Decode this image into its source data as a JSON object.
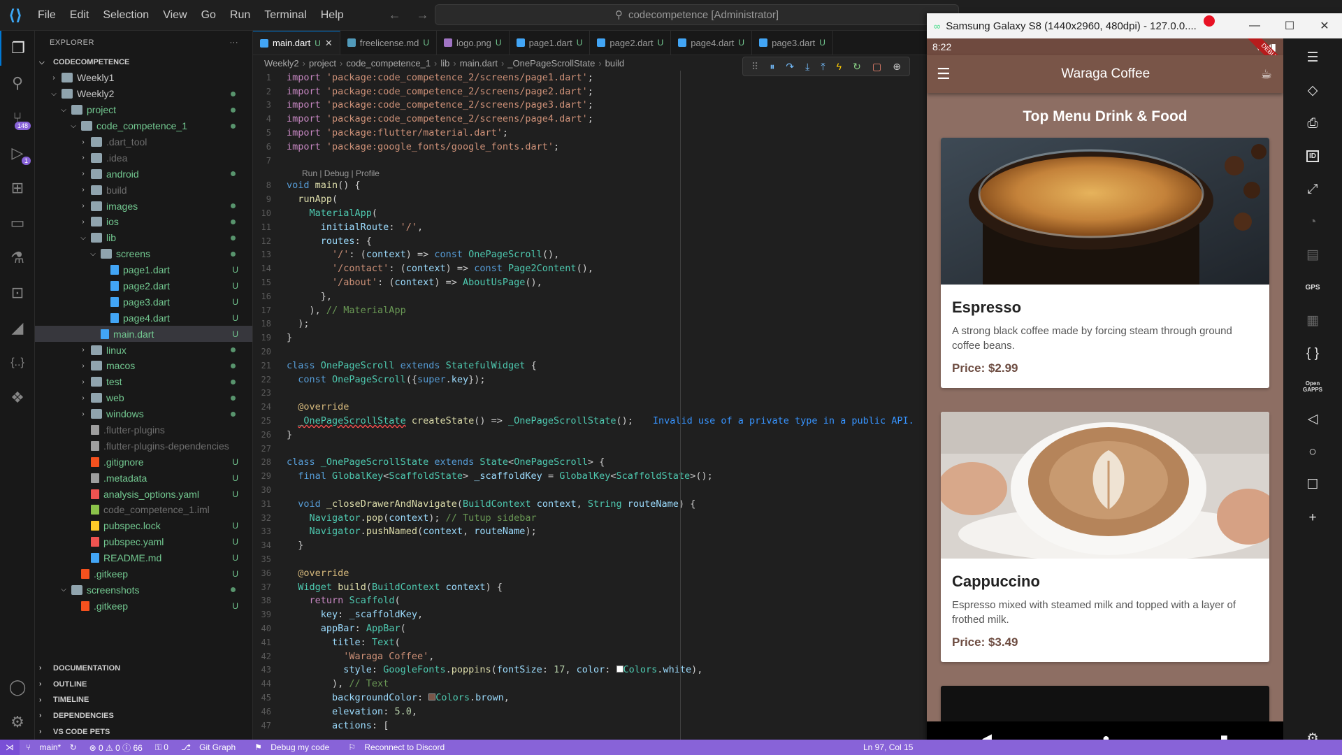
{
  "titlebar": {
    "menu": [
      "File",
      "Edit",
      "Selection",
      "View",
      "Go",
      "Run",
      "Terminal",
      "Help"
    ],
    "search_text": "codecompetence [Administrator]"
  },
  "activity": {
    "icons": [
      "files-icon",
      "search-icon",
      "source-control-icon",
      "run-debug-icon",
      "extensions-icon",
      "remote-explorer-icon",
      "testing-icon",
      "terminal-icon",
      "flutter-icon",
      "json-icon",
      "pets-icon"
    ],
    "scm_badge": "148",
    "debug_badge": "1"
  },
  "explorer": {
    "header": "EXPLORER",
    "more": "···",
    "root": "CODECOMPETENCE",
    "tree": [
      {
        "label": "Weekly1",
        "depth": 1,
        "type": "folder",
        "state": "closed",
        "color": "#cccccc",
        "mark": ""
      },
      {
        "label": "Weekly2",
        "depth": 1,
        "type": "folder",
        "state": "open",
        "color": "#cccccc",
        "mark": "dot"
      },
      {
        "label": "project",
        "depth": 2,
        "type": "folder",
        "state": "open",
        "color": "#73c991",
        "mark": "dot"
      },
      {
        "label": "code_competence_1",
        "depth": 3,
        "type": "folder",
        "state": "open",
        "color": "#73c991",
        "mark": "dot"
      },
      {
        "label": ".dart_tool",
        "depth": 4,
        "type": "folder",
        "state": "closed",
        "color": "#6e6e6e",
        "mark": ""
      },
      {
        "label": ".idea",
        "depth": 4,
        "type": "folder",
        "state": "closed",
        "color": "#6e6e6e",
        "mark": ""
      },
      {
        "label": "android",
        "depth": 4,
        "type": "folder",
        "state": "closed",
        "color": "#73c991",
        "mark": "dot"
      },
      {
        "label": "build",
        "depth": 4,
        "type": "folder",
        "state": "closed",
        "color": "#6e6e6e",
        "mark": ""
      },
      {
        "label": "images",
        "depth": 4,
        "type": "folder",
        "state": "closed",
        "color": "#73c991",
        "mark": "dot"
      },
      {
        "label": "ios",
        "depth": 4,
        "type": "folder",
        "state": "closed",
        "color": "#73c991",
        "mark": "dot"
      },
      {
        "label": "lib",
        "depth": 4,
        "type": "folder",
        "state": "open",
        "color": "#73c991",
        "mark": "dot"
      },
      {
        "label": "screens",
        "depth": 5,
        "type": "folder",
        "state": "open",
        "color": "#73c991",
        "mark": "dot"
      },
      {
        "label": "page1.dart",
        "depth": 6,
        "type": "dart",
        "state": "",
        "color": "#73c991",
        "mark": "U"
      },
      {
        "label": "page2.dart",
        "depth": 6,
        "type": "dart",
        "state": "",
        "color": "#73c991",
        "mark": "U"
      },
      {
        "label": "page3.dart",
        "depth": 6,
        "type": "dart",
        "state": "",
        "color": "#73c991",
        "mark": "U"
      },
      {
        "label": "page4.dart",
        "depth": 6,
        "type": "dart",
        "state": "",
        "color": "#73c991",
        "mark": "U"
      },
      {
        "label": "main.dart",
        "depth": 5,
        "type": "dart",
        "state": "",
        "color": "#73c991",
        "mark": "U",
        "selected": true
      },
      {
        "label": "linux",
        "depth": 4,
        "type": "folder",
        "state": "closed",
        "color": "#73c991",
        "mark": "dot"
      },
      {
        "label": "macos",
        "depth": 4,
        "type": "folder",
        "state": "closed",
        "color": "#73c991",
        "mark": "dot"
      },
      {
        "label": "test",
        "depth": 4,
        "type": "folder",
        "state": "closed",
        "color": "#73c991",
        "mark": "dot"
      },
      {
        "label": "web",
        "depth": 4,
        "type": "folder",
        "state": "closed",
        "color": "#73c991",
        "mark": "dot"
      },
      {
        "label": "windows",
        "depth": 4,
        "type": "folder",
        "state": "closed",
        "color": "#73c991",
        "mark": "dot"
      },
      {
        "label": ".flutter-plugins",
        "depth": 4,
        "type": "file",
        "state": "",
        "color": "#6e6e6e",
        "mark": ""
      },
      {
        "label": ".flutter-plugins-dependencies",
        "depth": 4,
        "type": "file",
        "state": "",
        "color": "#6e6e6e",
        "mark": ""
      },
      {
        "label": ".gitignore",
        "depth": 4,
        "type": "git",
        "state": "",
        "color": "#73c991",
        "mark": "U"
      },
      {
        "label": ".metadata",
        "depth": 4,
        "type": "file",
        "state": "",
        "color": "#73c991",
        "mark": "U"
      },
      {
        "label": "analysis_options.yaml",
        "depth": 4,
        "type": "yaml",
        "state": "",
        "color": "#73c991",
        "mark": "U"
      },
      {
        "label": "code_competence_1.iml",
        "depth": 4,
        "type": "iml",
        "state": "",
        "color": "#6e6e6e",
        "mark": ""
      },
      {
        "label": "pubspec.lock",
        "depth": 4,
        "type": "lock",
        "state": "",
        "color": "#73c991",
        "mark": "U"
      },
      {
        "label": "pubspec.yaml",
        "depth": 4,
        "type": "yaml",
        "state": "",
        "color": "#73c991",
        "mark": "U"
      },
      {
        "label": "README.md",
        "depth": 4,
        "type": "info",
        "state": "",
        "color": "#73c991",
        "mark": "U"
      },
      {
        "label": ".gitkeep",
        "depth": 3,
        "type": "git",
        "state": "",
        "color": "#73c991",
        "mark": "U"
      },
      {
        "label": "screenshots",
        "depth": 2,
        "type": "folder",
        "state": "open",
        "color": "#73c991",
        "mark": "dot"
      },
      {
        "label": ".gitkeep",
        "depth": 3,
        "type": "git",
        "state": "",
        "color": "#73c991",
        "mark": "U"
      }
    ],
    "sections": [
      "DOCUMENTATION",
      "OUTLINE",
      "TIMELINE",
      "DEPENDENCIES",
      "VS CODE PETS"
    ]
  },
  "editor": {
    "tabs": [
      {
        "label": "main.dart",
        "mark": "U",
        "active": true,
        "icon_color": "#42a5f5"
      },
      {
        "label": "freelicense.md",
        "mark": "U",
        "active": false,
        "icon_color": "#519aba"
      },
      {
        "label": "logo.png",
        "mark": "U",
        "active": false,
        "icon_color": "#a074c4"
      },
      {
        "label": "page1.dart",
        "mark": "U",
        "active": false,
        "icon_color": "#42a5f5"
      },
      {
        "label": "page2.dart",
        "mark": "U",
        "active": false,
        "icon_color": "#42a5f5"
      },
      {
        "label": "page4.dart",
        "mark": "U",
        "active": false,
        "icon_color": "#42a5f5"
      },
      {
        "label": "page3.dart",
        "mark": "U",
        "active": false,
        "icon_color": "#42a5f5"
      }
    ],
    "breadcrumb": [
      "Weekly2",
      "project",
      "code_competence_1",
      "lib",
      "main.dart",
      "_OnePageScrollState",
      "build"
    ],
    "codelens": "Run | Debug | Profile",
    "inline_error": "Invalid use of a private type in a public API.",
    "debug_controls": [
      "drag-handle-icon",
      "pause-icon",
      "step-over-icon",
      "step-into-icon",
      "step-out-icon",
      "hot-reload-icon",
      "restart-icon",
      "stop-icon",
      "inspect-icon"
    ]
  },
  "statusbar": {
    "branch": "main*",
    "problems": "⊗ 0 ⚠ 0 ⓘ 66",
    "ports": "⚿ 0",
    "git_graph": "Git Graph",
    "debug": "Debug my code",
    "discord": "Reconnect to Discord",
    "position": "Ln 97, Col 15"
  },
  "emulator": {
    "title": "Samsung Galaxy S8 (1440x2960, 480dpi) - 127.0.0....",
    "time": "8:22",
    "debug_ribbon": "DEBUG",
    "app_title": "Waraga Coffee",
    "heading": "Top Menu Drink & Food",
    "items": [
      {
        "name": "Espresso",
        "desc": "A strong black coffee made by forcing steam through ground coffee beans.",
        "price": "Price: $2.99"
      },
      {
        "name": "Cappuccino",
        "desc": "Espresso mixed with steamed milk and topped with a layer of frothed milk.",
        "price": "Price: $3.49"
      }
    ],
    "tools": [
      "menu-icon",
      "rotate-icon",
      "camera-icon",
      "id-icon",
      "resize-icon",
      "rss-icon",
      "sdcard-icon",
      "gps-icon",
      "film-icon",
      "braces-icon",
      "opengapps-icon",
      "back-icon",
      "home-icon",
      "overview-icon",
      "plus-icon",
      "gear-icon"
    ],
    "gps_label": "GPS",
    "opengapps_label": "Open GAPPS",
    "id_label": "ID"
  },
  "colors": {
    "accent": "#0078d4",
    "statusbar": "#8863d8",
    "coffee_appbar": "#795548",
    "coffee_bg": "#8d6e63",
    "price": "#6d4c41"
  }
}
